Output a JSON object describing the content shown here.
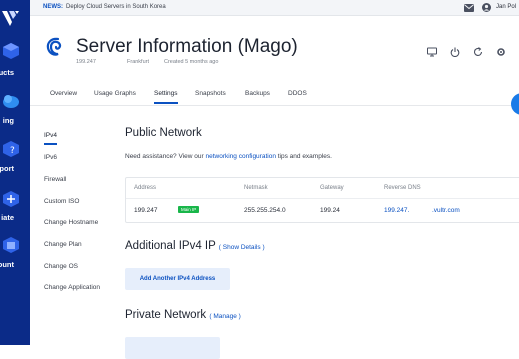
{
  "colors": {
    "sidebar": "#0b2b88",
    "accent": "#0b51c1",
    "badge": "#19b64a"
  },
  "sidebar": {
    "items": [
      {
        "label": "ucts",
        "icon": "products-icon"
      },
      {
        "label": "ing",
        "icon": "billing-icon"
      },
      {
        "label": "port",
        "icon": "support-icon"
      },
      {
        "label": "iate",
        "icon": "affiliate-icon"
      },
      {
        "label": "ount",
        "icon": "account-icon"
      }
    ]
  },
  "topbar": {
    "news_tag": "NEWS:",
    "news_text": "Deploy Cloud Servers in South Korea",
    "user_name": "Jan Pol"
  },
  "header": {
    "title": "Server Information (Mago)",
    "ip": "199.247",
    "location": "Frankfurt",
    "created": "Created 5 months ago"
  },
  "tabs": [
    {
      "label": "Overview",
      "active": false
    },
    {
      "label": "Usage Graphs",
      "active": false
    },
    {
      "label": "Settings",
      "active": true
    },
    {
      "label": "Snapshots",
      "active": false
    },
    {
      "label": "Backups",
      "active": false
    },
    {
      "label": "DDOS",
      "active": false
    }
  ],
  "subnav": [
    {
      "label": "IPv4",
      "active": true
    },
    {
      "label": "IPv6",
      "active": false
    },
    {
      "label": "Firewall",
      "active": false
    },
    {
      "label": "Custom ISO",
      "active": false
    },
    {
      "label": "Change Hostname",
      "active": false
    },
    {
      "label": "Change Plan",
      "active": false
    },
    {
      "label": "Change OS",
      "active": false
    },
    {
      "label": "Change Application",
      "active": false
    }
  ],
  "public_network": {
    "title": "Public Network",
    "help_prefix": "Need assistance? View our ",
    "help_link": "networking configuration",
    "help_suffix": " tips and examples.",
    "columns": [
      "Address",
      "Netmask",
      "Gateway",
      "Reverse DNS"
    ],
    "row": {
      "address": "199.247",
      "badge": "Main IP",
      "netmask": "255.255.254.0",
      "gateway": "199.24",
      "reverse_dns_prefix": "199.247.",
      "reverse_dns_suffix": ".vultr.com"
    }
  },
  "additional_ipv4": {
    "title": "Additional IPv4 IP",
    "link": "( Show Details )",
    "button": "Add Another IPv4 Address"
  },
  "private_network": {
    "title": "Private Network",
    "link": "( Manage )"
  }
}
